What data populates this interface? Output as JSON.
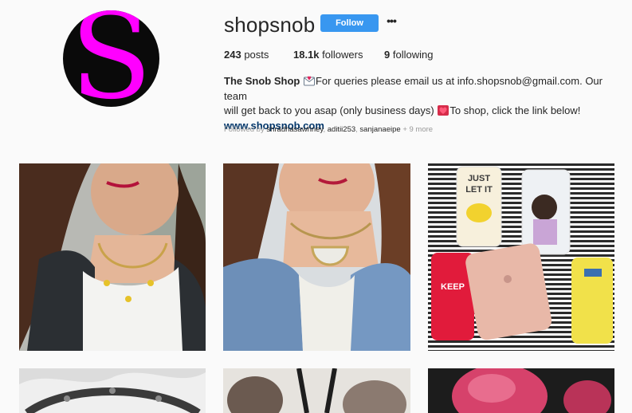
{
  "profile": {
    "username": "shopsnob",
    "avatar_letter": "S",
    "follow_label": "Follow",
    "more_label": "•••",
    "stats": {
      "posts_count": "243",
      "posts_label": "posts",
      "followers_count": "18.1k",
      "followers_label": "followers",
      "following_count": "9",
      "following_label": "following"
    },
    "bio": {
      "name": "The Snob Shop",
      "text1": "For queries please email us at info.shopsnob@gmail.com. Our team",
      "text2": "will get back to you asap (only business days)",
      "text3": "To shop, click the link below!",
      "website": "www.shopsnob.com"
    },
    "followed_by": {
      "prefix": "Followed by",
      "users": [
        "shradhasawhney",
        "aditii253",
        "sanjanaeipe"
      ],
      "more": "+ 9 more"
    }
  },
  "posts": [
    {
      "subject": "pineapple-necklace"
    },
    {
      "subject": "half-moon-choker"
    },
    {
      "subject": "phone-cases"
    },
    {
      "subject": "beaded-necklace"
    },
    {
      "subject": "pompom-keychain"
    },
    {
      "subject": "pink-accessory"
    }
  ],
  "colors": {
    "brand_magenta": "#ff00ff",
    "follow_blue": "#3897f0",
    "link_blue": "#003569"
  }
}
